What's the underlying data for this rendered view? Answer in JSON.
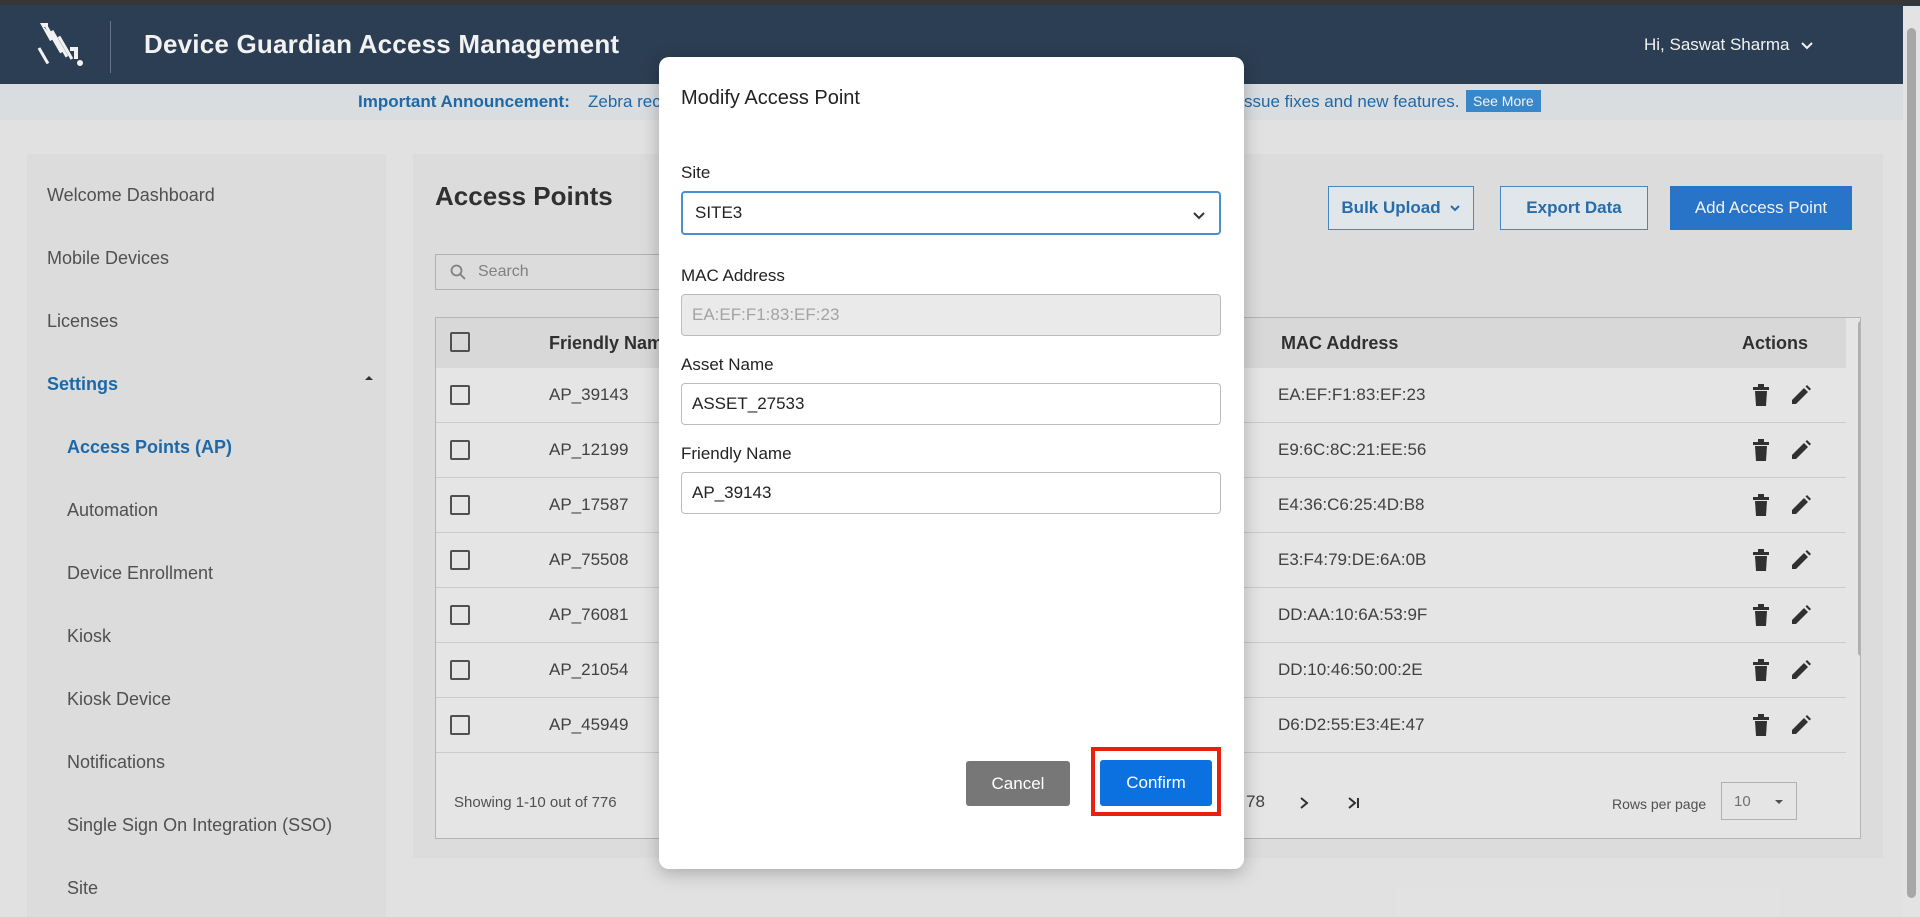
{
  "header": {
    "title": "Device Guardian Access Management",
    "user_greeting": "Hi, Saswat Sharma"
  },
  "announcement": {
    "label": "Important Announcement:",
    "text_left": "Zebra rec",
    "text_right": "ssue fixes and new features.",
    "see_more": "See More"
  },
  "sidebar": {
    "items": [
      {
        "label": "Welcome Dashboard"
      },
      {
        "label": "Mobile Devices"
      },
      {
        "label": "Licenses"
      },
      {
        "label": "Settings"
      },
      {
        "label": "Access Points (AP)"
      },
      {
        "label": "Automation"
      },
      {
        "label": "Device Enrollment"
      },
      {
        "label": "Kiosk"
      },
      {
        "label": "Kiosk Device"
      },
      {
        "label": "Notifications"
      },
      {
        "label": "Single Sign On Integration (SSO)"
      },
      {
        "label": "Site"
      }
    ]
  },
  "main": {
    "title": "Access Points",
    "bulk_upload": "Bulk Upload",
    "export_data": "Export Data",
    "add_access_point": "Add Access Point",
    "search_placeholder": "Search",
    "columns": {
      "friendly_name": "Friendly Nam",
      "mac_address": "MAC Address",
      "actions": "Actions"
    },
    "rows": [
      {
        "name": "AP_39143",
        "mac": "EA:EF:F1:83:EF:23"
      },
      {
        "name": "AP_12199",
        "mac": "E9:6C:8C:21:EE:56"
      },
      {
        "name": "AP_17587",
        "mac": "E4:36:C6:25:4D:B8"
      },
      {
        "name": "AP_75508",
        "mac": "E3:F4:79:DE:6A:0B"
      },
      {
        "name": "AP_76081",
        "mac": "DD:AA:10:6A:53:9F"
      },
      {
        "name": "AP_21054",
        "mac": "DD:10:46:50:00:2E"
      },
      {
        "name": "AP_45949",
        "mac": "D6:D2:55:E3:4E:47"
      }
    ],
    "footer": {
      "showing": "Showing 1-10 out of 776",
      "last_page": "78",
      "rows_per_page_label": "Rows per page",
      "rows_per_page_value": "10"
    }
  },
  "modal": {
    "title": "Modify Access Point",
    "site_label": "Site",
    "site_value": "SITE3",
    "mac_label": "MAC Address",
    "mac_value": "EA:EF:F1:83:EF:23",
    "asset_label": "Asset Name",
    "asset_value": "ASSET_27533",
    "friendly_label": "Friendly Name",
    "friendly_value": "AP_39143",
    "cancel": "Cancel",
    "confirm": "Confirm"
  },
  "colors": {
    "header_bg": "#2f4258",
    "accent": "#2a7bd4",
    "confirm": "#0c71e0",
    "highlight": "#e82010"
  }
}
